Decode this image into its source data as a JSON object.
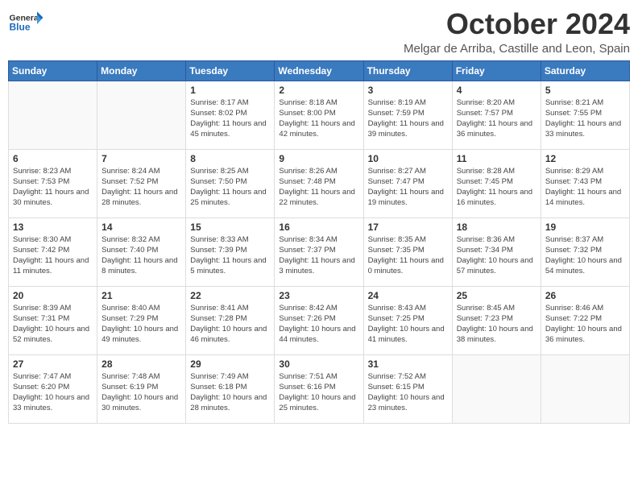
{
  "header": {
    "logo_general": "General",
    "logo_blue": "Blue",
    "month": "October 2024",
    "location": "Melgar de Arriba, Castille and Leon, Spain"
  },
  "weekdays": [
    "Sunday",
    "Monday",
    "Tuesday",
    "Wednesday",
    "Thursday",
    "Friday",
    "Saturday"
  ],
  "weeks": [
    [
      {
        "day": "",
        "info": ""
      },
      {
        "day": "",
        "info": ""
      },
      {
        "day": "1",
        "info": "Sunrise: 8:17 AM\nSunset: 8:02 PM\nDaylight: 11 hours and 45 minutes."
      },
      {
        "day": "2",
        "info": "Sunrise: 8:18 AM\nSunset: 8:00 PM\nDaylight: 11 hours and 42 minutes."
      },
      {
        "day": "3",
        "info": "Sunrise: 8:19 AM\nSunset: 7:59 PM\nDaylight: 11 hours and 39 minutes."
      },
      {
        "day": "4",
        "info": "Sunrise: 8:20 AM\nSunset: 7:57 PM\nDaylight: 11 hours and 36 minutes."
      },
      {
        "day": "5",
        "info": "Sunrise: 8:21 AM\nSunset: 7:55 PM\nDaylight: 11 hours and 33 minutes."
      }
    ],
    [
      {
        "day": "6",
        "info": "Sunrise: 8:23 AM\nSunset: 7:53 PM\nDaylight: 11 hours and 30 minutes."
      },
      {
        "day": "7",
        "info": "Sunrise: 8:24 AM\nSunset: 7:52 PM\nDaylight: 11 hours and 28 minutes."
      },
      {
        "day": "8",
        "info": "Sunrise: 8:25 AM\nSunset: 7:50 PM\nDaylight: 11 hours and 25 minutes."
      },
      {
        "day": "9",
        "info": "Sunrise: 8:26 AM\nSunset: 7:48 PM\nDaylight: 11 hours and 22 minutes."
      },
      {
        "day": "10",
        "info": "Sunrise: 8:27 AM\nSunset: 7:47 PM\nDaylight: 11 hours and 19 minutes."
      },
      {
        "day": "11",
        "info": "Sunrise: 8:28 AM\nSunset: 7:45 PM\nDaylight: 11 hours and 16 minutes."
      },
      {
        "day": "12",
        "info": "Sunrise: 8:29 AM\nSunset: 7:43 PM\nDaylight: 11 hours and 14 minutes."
      }
    ],
    [
      {
        "day": "13",
        "info": "Sunrise: 8:30 AM\nSunset: 7:42 PM\nDaylight: 11 hours and 11 minutes."
      },
      {
        "day": "14",
        "info": "Sunrise: 8:32 AM\nSunset: 7:40 PM\nDaylight: 11 hours and 8 minutes."
      },
      {
        "day": "15",
        "info": "Sunrise: 8:33 AM\nSunset: 7:39 PM\nDaylight: 11 hours and 5 minutes."
      },
      {
        "day": "16",
        "info": "Sunrise: 8:34 AM\nSunset: 7:37 PM\nDaylight: 11 hours and 3 minutes."
      },
      {
        "day": "17",
        "info": "Sunrise: 8:35 AM\nSunset: 7:35 PM\nDaylight: 11 hours and 0 minutes."
      },
      {
        "day": "18",
        "info": "Sunrise: 8:36 AM\nSunset: 7:34 PM\nDaylight: 10 hours and 57 minutes."
      },
      {
        "day": "19",
        "info": "Sunrise: 8:37 AM\nSunset: 7:32 PM\nDaylight: 10 hours and 54 minutes."
      }
    ],
    [
      {
        "day": "20",
        "info": "Sunrise: 8:39 AM\nSunset: 7:31 PM\nDaylight: 10 hours and 52 minutes."
      },
      {
        "day": "21",
        "info": "Sunrise: 8:40 AM\nSunset: 7:29 PM\nDaylight: 10 hours and 49 minutes."
      },
      {
        "day": "22",
        "info": "Sunrise: 8:41 AM\nSunset: 7:28 PM\nDaylight: 10 hours and 46 minutes."
      },
      {
        "day": "23",
        "info": "Sunrise: 8:42 AM\nSunset: 7:26 PM\nDaylight: 10 hours and 44 minutes."
      },
      {
        "day": "24",
        "info": "Sunrise: 8:43 AM\nSunset: 7:25 PM\nDaylight: 10 hours and 41 minutes."
      },
      {
        "day": "25",
        "info": "Sunrise: 8:45 AM\nSunset: 7:23 PM\nDaylight: 10 hours and 38 minutes."
      },
      {
        "day": "26",
        "info": "Sunrise: 8:46 AM\nSunset: 7:22 PM\nDaylight: 10 hours and 36 minutes."
      }
    ],
    [
      {
        "day": "27",
        "info": "Sunrise: 7:47 AM\nSunset: 6:20 PM\nDaylight: 10 hours and 33 minutes."
      },
      {
        "day": "28",
        "info": "Sunrise: 7:48 AM\nSunset: 6:19 PM\nDaylight: 10 hours and 30 minutes."
      },
      {
        "day": "29",
        "info": "Sunrise: 7:49 AM\nSunset: 6:18 PM\nDaylight: 10 hours and 28 minutes."
      },
      {
        "day": "30",
        "info": "Sunrise: 7:51 AM\nSunset: 6:16 PM\nDaylight: 10 hours and 25 minutes."
      },
      {
        "day": "31",
        "info": "Sunrise: 7:52 AM\nSunset: 6:15 PM\nDaylight: 10 hours and 23 minutes."
      },
      {
        "day": "",
        "info": ""
      },
      {
        "day": "",
        "info": ""
      }
    ]
  ]
}
